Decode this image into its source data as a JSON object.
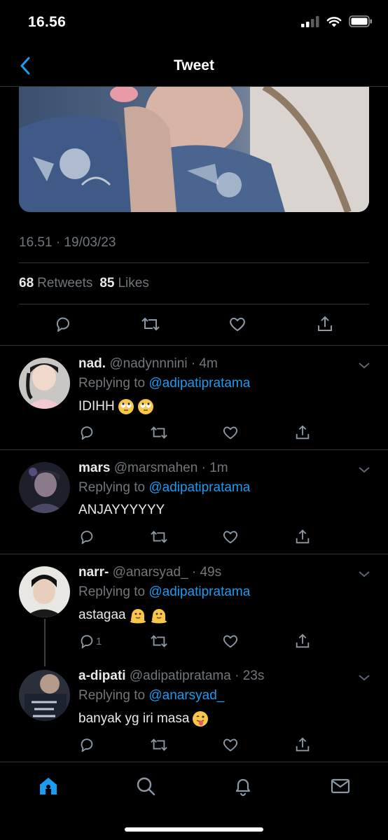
{
  "status_bar": {
    "time": "16.56"
  },
  "nav": {
    "title": "Tweet"
  },
  "tweet": {
    "timestamp": "16.51 · 19/03/23",
    "retweets_count": "68",
    "retweets_label": "Retweets",
    "likes_count": "85",
    "likes_label": "Likes"
  },
  "replies": [
    {
      "name": "nad.",
      "handle": "@nadynnnini · 4m",
      "replying_prefix": "Replying to",
      "replying_to": "@adipatipratama",
      "text": "IDIHH",
      "emojis": [
        "rolling-eyes",
        "rolling-eyes"
      ],
      "reply_count": ""
    },
    {
      "name": "mars",
      "handle": "@marsmahen · 1m",
      "replying_prefix": "Replying to",
      "replying_to": "@adipatipratama",
      "text": "ANJAYYYYYY",
      "emojis": [],
      "reply_count": ""
    },
    {
      "name": "narr-",
      "handle": "@anarsyad_ · 49s",
      "replying_prefix": "Replying to",
      "replying_to": "@adipatipratama",
      "text": "astagaa",
      "emojis": [
        "melting-face",
        "melting-face"
      ],
      "reply_count": "1"
    },
    {
      "name": "a-dipati",
      "handle": "@adipatipratama · 23s",
      "replying_prefix": "Replying to",
      "replying_to": "@anarsyad_",
      "text": "banyak yg iri masa",
      "emojis": [
        "tongue-face"
      ],
      "reply_count": ""
    }
  ],
  "colors": {
    "accent": "#1d9bf0",
    "muted": "#71767b",
    "divider": "#2f3336"
  },
  "tabs": [
    "home-icon",
    "search-icon",
    "notifications-icon",
    "messages-icon"
  ]
}
